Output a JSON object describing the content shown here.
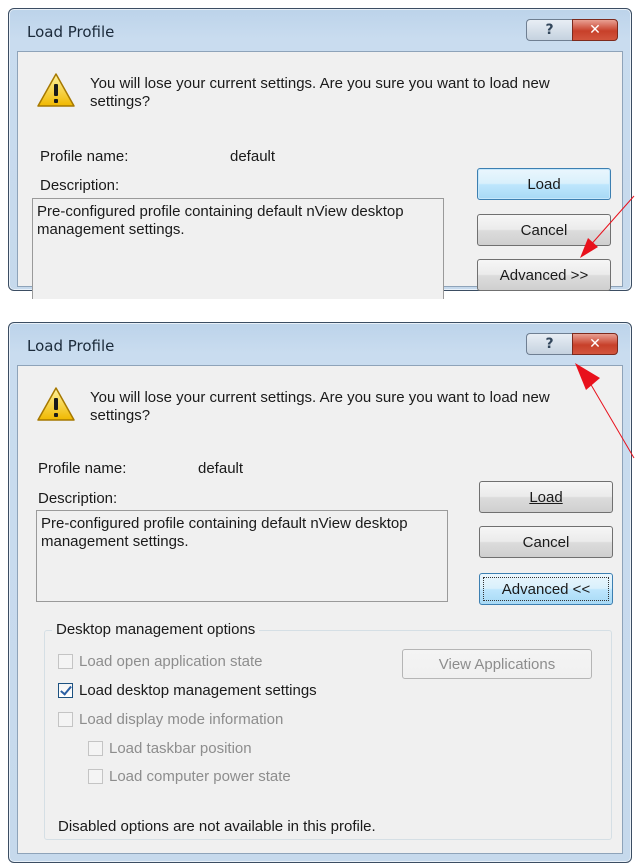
{
  "dialog1": {
    "title": "Load Profile",
    "help_glyph": "?",
    "close_glyph": "✕",
    "message": "You will lose your current settings. Are you sure you want to load new settings?",
    "profile_name_label": "Profile name:",
    "profile_name_value": "default",
    "description_label": "Description:",
    "description_text": "Pre-configured profile containing default nView desktop management settings.",
    "load_button": "Load",
    "cancel_button": "Cancel",
    "advanced_button": "Advanced >>"
  },
  "dialog2": {
    "title": "Load Profile",
    "help_glyph": "?",
    "close_glyph": "✕",
    "message": "You will lose your current settings. Are you sure you want to load new settings?",
    "profile_name_label": "Profile name:",
    "profile_name_value": "default",
    "description_label": "Description:",
    "description_text": "Pre-configured profile containing default nView desktop management settings.",
    "load_button": "Load",
    "cancel_button": "Cancel",
    "advanced_button": "Advanced <<",
    "group_title": "Desktop management options",
    "options": [
      {
        "label": "Load open application state",
        "checked": false,
        "enabled": false
      },
      {
        "label": "Load desktop management settings",
        "checked": true,
        "enabled": true
      },
      {
        "label": "Load display mode information",
        "checked": false,
        "enabled": false
      },
      {
        "label": "Load taskbar position",
        "checked": false,
        "enabled": false
      },
      {
        "label": "Load computer power state",
        "checked": false,
        "enabled": false
      }
    ],
    "view_applications_button": "View Applications",
    "footer_note": "Disabled options are not available in this profile."
  },
  "colors": {
    "annotation_arrow": "#e8111c",
    "close_button": "#c7402a",
    "title_bar": "#c6d9ec"
  }
}
